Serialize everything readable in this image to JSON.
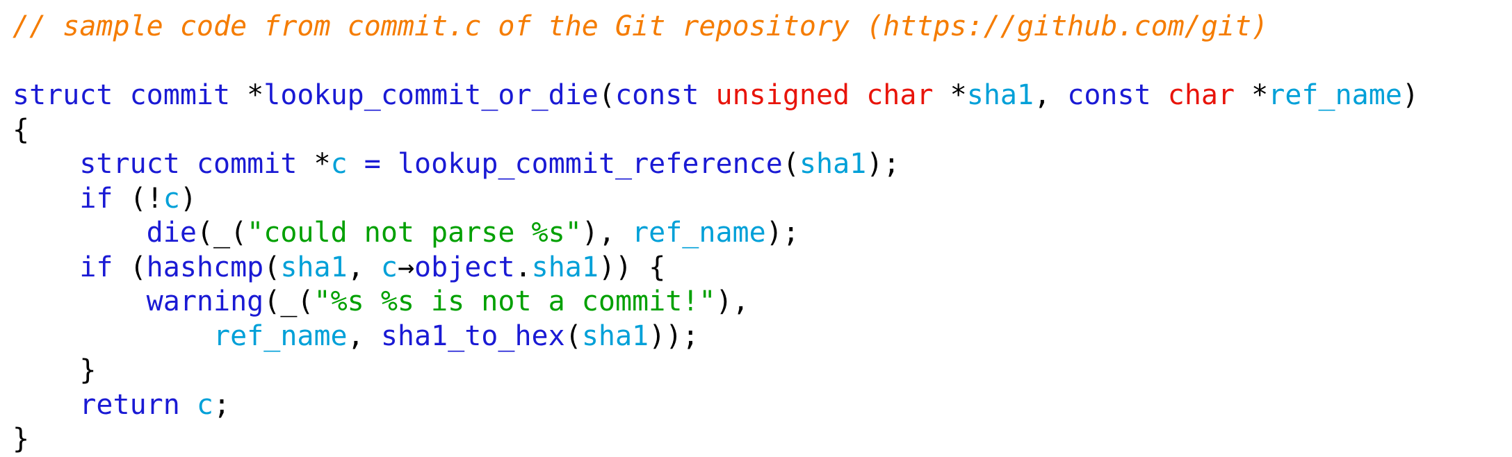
{
  "document": {
    "kind": "source-code-listing",
    "language": "C",
    "background_color": "#ffffff",
    "font_size_px": 40,
    "indent_width": 4
  },
  "palette": {
    "comment": "#f57c00",
    "keyword": "#1a1ad4",
    "function": "#1a1ad4",
    "type": "#e8140a",
    "identifier": "#00a0d8",
    "string": "#00a000",
    "punctuation": "#000000"
  },
  "code": {
    "lines": [
      {
        "id": "line-1-comment",
        "text": "// sample code from commit.c of the Git repository (https://github.com/git)",
        "tokens": [
          {
            "t": "// sample code from commit.c of the Git repository (https://github.com/git)",
            "c": "comment"
          }
        ]
      },
      {
        "id": "line-2-blank",
        "text": "",
        "tokens": []
      },
      {
        "id": "line-3-signature",
        "text": "struct commit *lookup_commit_or_die(const unsigned char *sha1, const char *ref_name)",
        "tokens": [
          {
            "t": "struct commit ",
            "c": "keyword"
          },
          {
            "t": "*",
            "c": "punct"
          },
          {
            "t": "lookup_commit_or_die",
            "c": "func"
          },
          {
            "t": "(",
            "c": "punct"
          },
          {
            "t": "const ",
            "c": "keyword"
          },
          {
            "t": "unsigned char ",
            "c": "type"
          },
          {
            "t": "*",
            "c": "punct"
          },
          {
            "t": "sha1",
            "c": "ident"
          },
          {
            "t": ", ",
            "c": "punct"
          },
          {
            "t": "const ",
            "c": "keyword"
          },
          {
            "t": "char ",
            "c": "type"
          },
          {
            "t": "*",
            "c": "punct"
          },
          {
            "t": "ref_name",
            "c": "ident"
          },
          {
            "t": ")",
            "c": "punct"
          }
        ]
      },
      {
        "id": "line-4-open-brace",
        "text": "{",
        "tokens": [
          {
            "t": "{",
            "c": "punct"
          }
        ]
      },
      {
        "id": "line-5-declaration",
        "text": "    struct commit *c = lookup_commit_reference(sha1);",
        "tokens": [
          {
            "t": "    ",
            "c": "plain"
          },
          {
            "t": "struct commit ",
            "c": "keyword"
          },
          {
            "t": "*",
            "c": "punct"
          },
          {
            "t": "c",
            "c": "ident"
          },
          {
            "t": " ",
            "c": "plain"
          },
          {
            "t": "=",
            "c": "keyword"
          },
          {
            "t": " ",
            "c": "plain"
          },
          {
            "t": "lookup_commit_reference",
            "c": "func"
          },
          {
            "t": "(",
            "c": "punct"
          },
          {
            "t": "sha1",
            "c": "ident"
          },
          {
            "t": ");",
            "c": "punct"
          }
        ]
      },
      {
        "id": "line-6-if-not-c",
        "text": "    if (!c)",
        "tokens": [
          {
            "t": "    ",
            "c": "plain"
          },
          {
            "t": "if",
            "c": "keyword"
          },
          {
            "t": " (!",
            "c": "punct"
          },
          {
            "t": "c",
            "c": "ident"
          },
          {
            "t": ")",
            "c": "punct"
          }
        ]
      },
      {
        "id": "line-7-die-call",
        "text": "        die(_(\"could not parse %s\"), ref_name);",
        "tokens": [
          {
            "t": "        ",
            "c": "plain"
          },
          {
            "t": "die",
            "c": "func"
          },
          {
            "t": "(_(",
            "c": "punct"
          },
          {
            "t": "\"could not parse %s\"",
            "c": "string"
          },
          {
            "t": "), ",
            "c": "punct"
          },
          {
            "t": "ref_name",
            "c": "ident"
          },
          {
            "t": ");",
            "c": "punct"
          }
        ]
      },
      {
        "id": "line-8-if-hashcmp",
        "text": "    if (hashcmp(sha1, c→object.sha1)) {",
        "tokens": [
          {
            "t": "    ",
            "c": "plain"
          },
          {
            "t": "if",
            "c": "keyword"
          },
          {
            "t": " (",
            "c": "punct"
          },
          {
            "t": "hashcmp",
            "c": "func"
          },
          {
            "t": "(",
            "c": "punct"
          },
          {
            "t": "sha1",
            "c": "ident"
          },
          {
            "t": ", ",
            "c": "punct"
          },
          {
            "t": "c",
            "c": "ident"
          },
          {
            "t": "→",
            "c": "punct"
          },
          {
            "t": "object",
            "c": "keyword"
          },
          {
            "t": ".",
            "c": "punct"
          },
          {
            "t": "sha1",
            "c": "ident"
          },
          {
            "t": ")) {",
            "c": "punct"
          }
        ]
      },
      {
        "id": "line-9-warning-call",
        "text": "        warning(_(\"%s %s is not a commit!\"),",
        "tokens": [
          {
            "t": "        ",
            "c": "plain"
          },
          {
            "t": "warning",
            "c": "func"
          },
          {
            "t": "(_(",
            "c": "punct"
          },
          {
            "t": "\"%s %s is not a commit!\"",
            "c": "string"
          },
          {
            "t": "),",
            "c": "punct"
          }
        ]
      },
      {
        "id": "line-10-warning-args",
        "text": "            ref_name, sha1_to_hex(sha1));",
        "tokens": [
          {
            "t": "            ",
            "c": "plain"
          },
          {
            "t": "ref_name",
            "c": "ident"
          },
          {
            "t": ", ",
            "c": "punct"
          },
          {
            "t": "sha1_to_hex",
            "c": "func"
          },
          {
            "t": "(",
            "c": "punct"
          },
          {
            "t": "sha1",
            "c": "ident"
          },
          {
            "t": "));",
            "c": "punct"
          }
        ]
      },
      {
        "id": "line-11-close-if-brace",
        "text": "    }",
        "tokens": [
          {
            "t": "    }",
            "c": "punct"
          }
        ]
      },
      {
        "id": "line-12-return",
        "text": "    return c;",
        "tokens": [
          {
            "t": "    ",
            "c": "plain"
          },
          {
            "t": "return",
            "c": "keyword"
          },
          {
            "t": " ",
            "c": "plain"
          },
          {
            "t": "c",
            "c": "ident"
          },
          {
            "t": ";",
            "c": "punct"
          }
        ]
      },
      {
        "id": "line-13-close-brace",
        "text": "}",
        "tokens": [
          {
            "t": "}",
            "c": "punct"
          }
        ]
      }
    ]
  }
}
